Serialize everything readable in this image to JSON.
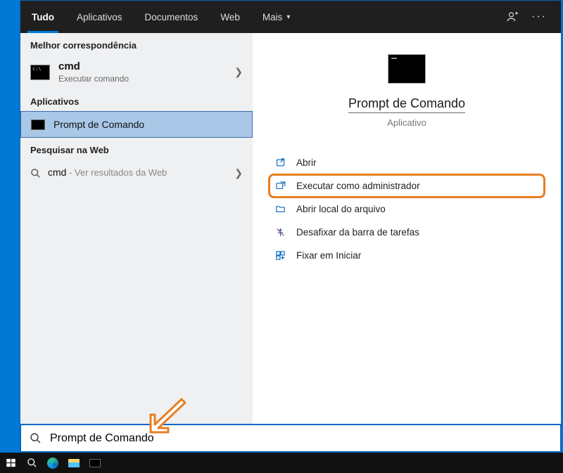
{
  "topbar": {
    "tabs": {
      "tudo": "Tudo",
      "aplicativos": "Aplicativos",
      "documentos": "Documentos",
      "web": "Web",
      "mais": "Mais"
    }
  },
  "left": {
    "best_match_header": "Melhor correspondência",
    "best_match": {
      "title": "cmd",
      "subtitle": "Executar comando"
    },
    "apps_header": "Aplicativos",
    "app_item": "Prompt de Comando",
    "web_header": "Pesquisar na Web",
    "web_term": "cmd",
    "web_hint": " - Ver resultados da Web"
  },
  "right": {
    "title": "Prompt de Comando",
    "subtitle": "Aplicativo",
    "actions": {
      "open": "Abrir",
      "run_admin": "Executar como administrador",
      "open_location": "Abrir local do arquivo",
      "unpin_taskbar": "Desafixar da barra de tarefas",
      "pin_start": "Fixar em Iniciar"
    }
  },
  "search": {
    "value": "Prompt de Comando"
  }
}
